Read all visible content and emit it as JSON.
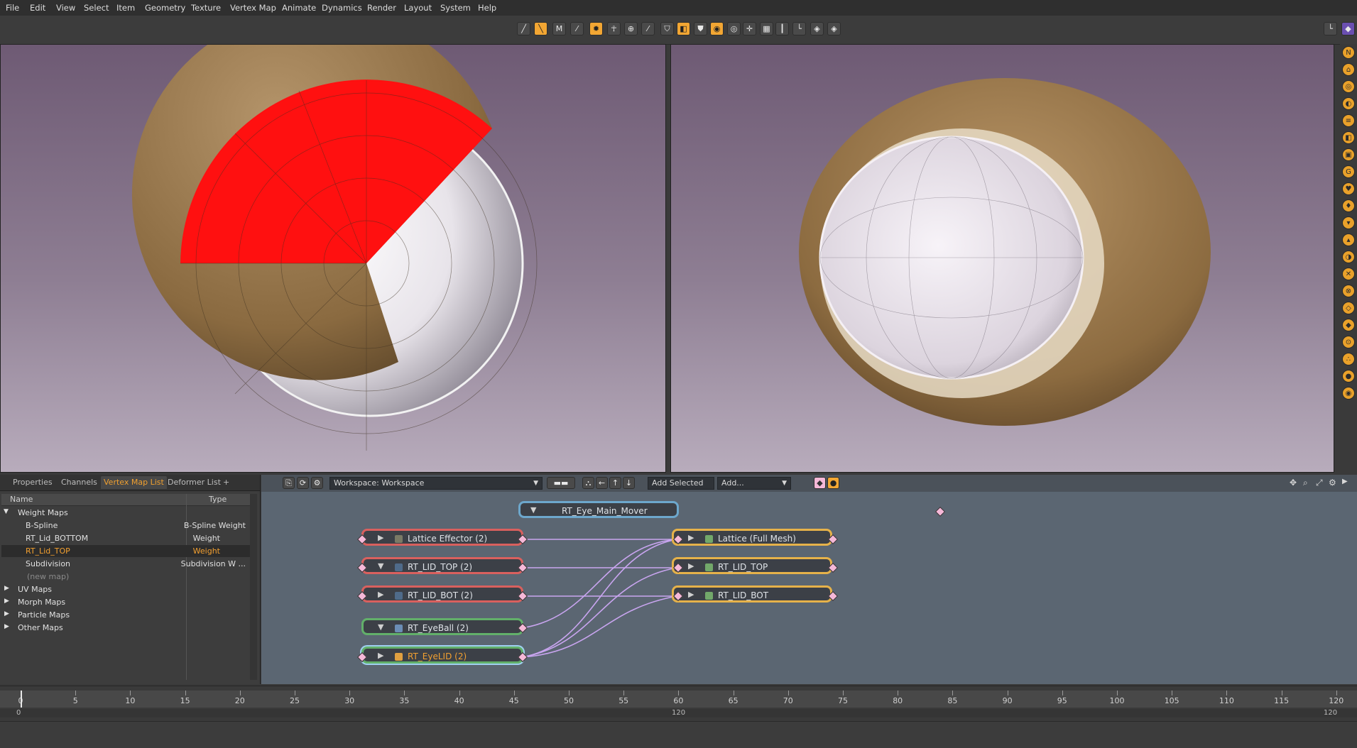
{
  "menu": [
    "File",
    "Edit",
    "View",
    "Select",
    "Item",
    "Geometry",
    "Texture",
    "Vertex Map",
    "Animate",
    "Dynamics",
    "Render",
    "Layout",
    "System",
    "Help"
  ],
  "panel_tabs": [
    "Properties",
    "Channels",
    "Vertex Map List",
    "Deformer List",
    "+"
  ],
  "list": {
    "col_name": "Name",
    "col_type": "Type",
    "groups": {
      "weight_maps": "Weight Maps",
      "uv_maps": "UV Maps",
      "morph_maps": "Morph Maps",
      "particle_maps": "Particle Maps",
      "other_maps": "Other Maps"
    },
    "items": [
      {
        "name": "B-Spline",
        "type": "B-Spline Weight"
      },
      {
        "name": "RT_Lid_BOTTOM",
        "type": "Weight"
      },
      {
        "name": "RT_Lid_TOP",
        "type": "Weight"
      },
      {
        "name": "Subdivision",
        "type": "Subdivision W ..."
      },
      {
        "name": "(new map)",
        "type": ""
      }
    ]
  },
  "schematic": {
    "workspace": "Workspace: Workspace",
    "add_selected": "Add Selected",
    "add": "Add...",
    "nodes": {
      "main_mover": "RT_Eye_Main_Mover",
      "lattice_effector": "Lattice Effector (2)",
      "lid_top_ctrl": "RT_LID_TOP (2)",
      "lid_bot_ctrl": "RT_LID_BOT (2)",
      "eyeball": "RT_EyeBall (2)",
      "eyelid": "RT_EyeLID (2)",
      "lattice_full": "Lattice (Full Mesh)",
      "lid_top": "RT_LID_TOP",
      "lid_bot": "RT_LID_BOT"
    }
  },
  "timeline": {
    "ticks": [
      "0",
      "5",
      "10",
      "15",
      "20",
      "25",
      "30",
      "35",
      "40",
      "45",
      "50",
      "55",
      "60",
      "65",
      "70",
      "75",
      "80",
      "85",
      "90",
      "95",
      "100",
      "105",
      "110",
      "115",
      "120"
    ],
    "start": "0",
    "mid": "120",
    "end": "120"
  },
  "colors": {
    "accent": "#f0a030",
    "lid_red": "#ff0000",
    "lid_brown": "#8a6a40"
  }
}
